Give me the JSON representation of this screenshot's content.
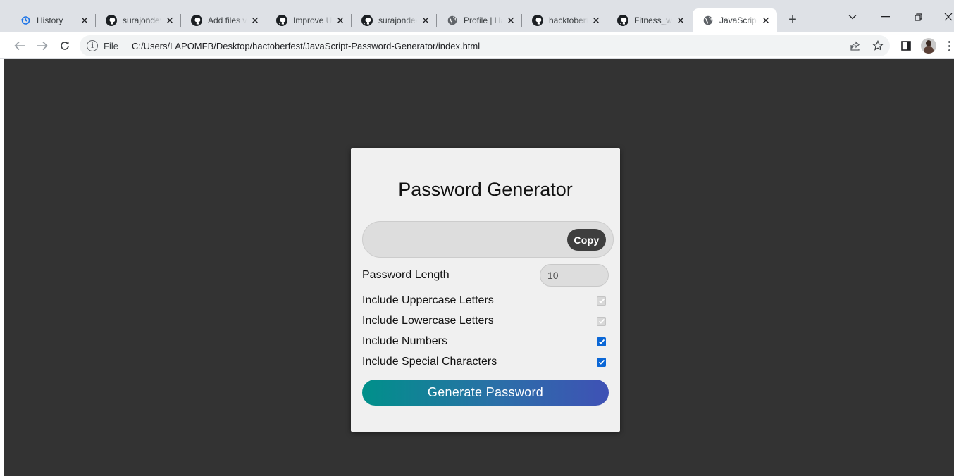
{
  "browser": {
    "tabs": [
      {
        "title": "History",
        "icon": "history-icon",
        "active": false
      },
      {
        "title": "surajondev",
        "icon": "github-icon",
        "active": false
      },
      {
        "title": "Add files via",
        "icon": "github-icon",
        "active": false
      },
      {
        "title": "Improve UI",
        "icon": "github-icon",
        "active": false
      },
      {
        "title": "surajondev",
        "icon": "github-icon",
        "active": false
      },
      {
        "title": "Profile | Hack",
        "icon": "globe-icon",
        "active": false
      },
      {
        "title": "hacktoberfest",
        "icon": "github-icon",
        "active": false
      },
      {
        "title": "Fitness_web",
        "icon": "github-icon",
        "active": false
      },
      {
        "title": "JavaScript",
        "icon": "globe-icon",
        "active": true
      }
    ],
    "address": {
      "scheme_label": "File",
      "url": "C:/Users/LAPOMFB/Desktop/hactoberfest/JavaScript-Password-Generator/index.html"
    }
  },
  "app": {
    "title": "Password Generator",
    "copy_label": "Copy",
    "result_value": "",
    "length": {
      "label": "Password Length",
      "value": "10"
    },
    "options": [
      {
        "label": "Include Uppercase Letters",
        "checked": true,
        "disabled": true
      },
      {
        "label": "Include Lowercase Letters",
        "checked": true,
        "disabled": true
      },
      {
        "label": "Include Numbers",
        "checked": true,
        "disabled": false
      },
      {
        "label": "Include Special Characters",
        "checked": true,
        "disabled": false
      }
    ],
    "generate_label": "Generate Password"
  },
  "colors": {
    "page_background": "#333333",
    "card_background": "#f0f0f0",
    "button_gradient_start": "#00908a",
    "button_gradient_end": "#3f51b5",
    "checkbox_checked": "#0b67d6"
  }
}
